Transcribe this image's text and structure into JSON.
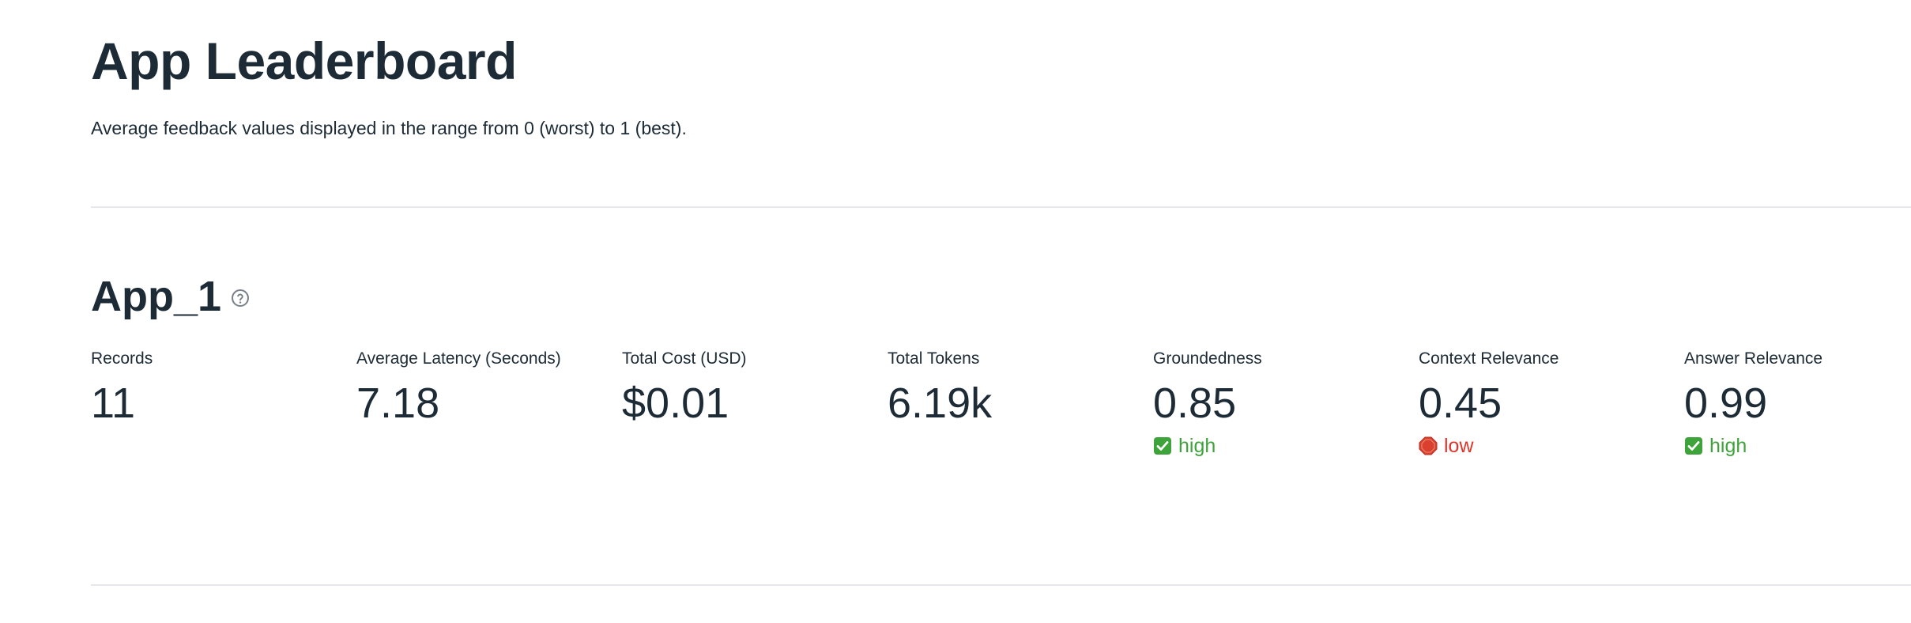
{
  "page": {
    "title": "App Leaderboard",
    "subtitle": "Average feedback values displayed in the range from 0 (worst) to 1 (best)."
  },
  "app": {
    "name": "App_1",
    "help_icon": "question-circle-icon"
  },
  "metrics": [
    {
      "label": "Records",
      "value": "11"
    },
    {
      "label": "Average Latency (Seconds)",
      "value": "7.18"
    },
    {
      "label": "Total Cost (USD)",
      "value": "$0.01"
    },
    {
      "label": "Total Tokens",
      "value": "6.19k"
    },
    {
      "label": "Groundedness",
      "value": "0.85",
      "delta": {
        "text": "high",
        "icon": "check-box-icon",
        "color": "#3fa33b"
      }
    },
    {
      "label": "Context Relevance",
      "value": "0.45",
      "delta": {
        "text": "low",
        "icon": "stop-sign-icon",
        "color": "#e0352b"
      }
    },
    {
      "label": "Answer Relevance",
      "value": "0.99",
      "delta": {
        "text": "high",
        "icon": "check-box-icon",
        "color": "#3fa33b"
      }
    }
  ],
  "colors": {
    "text": "#1d2b36",
    "divider": "#e6e8eb",
    "positive": "#3fa33b",
    "negative": "#e0352b"
  }
}
